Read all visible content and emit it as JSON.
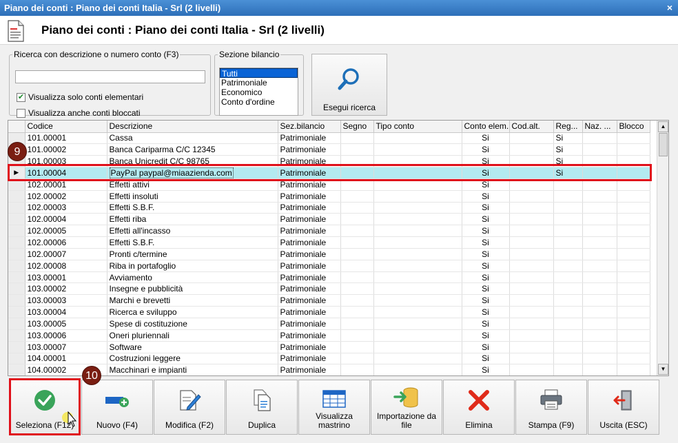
{
  "window": {
    "title": "Piano dei conti : Piano dei conti Italia - Srl (2 livelli)",
    "close_glyph": "×"
  },
  "header": {
    "title": "Piano dei conti : Piano dei conti Italia - Srl (2 livelli)",
    "icon": "document-icon"
  },
  "search": {
    "legend": "Ricerca con descrizione o numero conto (F3)",
    "value": "",
    "placeholder": "",
    "checkbox_elementari": {
      "label": "Visualizza solo conti elementari",
      "checked": true
    },
    "checkbox_bloccati": {
      "label": "Visualizza anche conti bloccati",
      "checked": false
    }
  },
  "sezione": {
    "legend": "Sezione bilancio",
    "options": [
      "Tutti",
      "Patrimoniale",
      "Economico",
      "Conto d'ordine"
    ],
    "selected": "Tutti"
  },
  "search_button": {
    "label": "Esegui ricerca",
    "icon": "magnifier-icon"
  },
  "grid": {
    "columns": [
      "Codice",
      "Descrizione",
      "Sez.bilancio",
      "Segno",
      "Tipo conto",
      "Conto elem.",
      "Cod.alt.",
      "Reg...",
      "Naz. ...",
      "Blocco"
    ],
    "selected_row_index": 3,
    "rows": [
      [
        "101.00001",
        "Cassa",
        "Patrimoniale",
        "",
        "",
        "Si",
        "",
        "Si",
        "",
        ""
      ],
      [
        "101.00002",
        "Banca Cariparma C/C 12345",
        "Patrimoniale",
        "",
        "",
        "Si",
        "",
        "Si",
        "",
        ""
      ],
      [
        "101.00003",
        "Banca Unicredit C/C 98765",
        "Patrimoniale",
        "",
        "",
        "Si",
        "",
        "Si",
        "",
        ""
      ],
      [
        "101.00004",
        "PayPal paypal@miaazienda.com",
        "Patrimoniale",
        "",
        "",
        "Si",
        "",
        "Si",
        "",
        ""
      ],
      [
        "102.00001",
        "Effetti attivi",
        "Patrimoniale",
        "",
        "",
        "Si",
        "",
        "",
        "",
        ""
      ],
      [
        "102.00002",
        "Effetti insoluti",
        "Patrimoniale",
        "",
        "",
        "Si",
        "",
        "",
        "",
        ""
      ],
      [
        "102.00003",
        "Effetti S.B.F.",
        "Patrimoniale",
        "",
        "",
        "Si",
        "",
        "",
        "",
        ""
      ],
      [
        "102.00004",
        "Effetti riba",
        "Patrimoniale",
        "",
        "",
        "Si",
        "",
        "",
        "",
        ""
      ],
      [
        "102.00005",
        "Effetti all'incasso",
        "Patrimoniale",
        "",
        "",
        "Si",
        "",
        "",
        "",
        ""
      ],
      [
        "102.00006",
        "Effetti S.B.F.",
        "Patrimoniale",
        "",
        "",
        "Si",
        "",
        "",
        "",
        ""
      ],
      [
        "102.00007",
        "Pronti c/termine",
        "Patrimoniale",
        "",
        "",
        "Si",
        "",
        "",
        "",
        ""
      ],
      [
        "102.00008",
        "Riba in portafoglio",
        "Patrimoniale",
        "",
        "",
        "Si",
        "",
        "",
        "",
        ""
      ],
      [
        "103.00001",
        "Avviamento",
        "Patrimoniale",
        "",
        "",
        "Si",
        "",
        "",
        "",
        ""
      ],
      [
        "103.00002",
        "Insegne e pubblicità",
        "Patrimoniale",
        "",
        "",
        "Si",
        "",
        "",
        "",
        ""
      ],
      [
        "103.00003",
        "Marchi e brevetti",
        "Patrimoniale",
        "",
        "",
        "Si",
        "",
        "",
        "",
        ""
      ],
      [
        "103.00004",
        "Ricerca e sviluppo",
        "Patrimoniale",
        "",
        "",
        "Si",
        "",
        "",
        "",
        ""
      ],
      [
        "103.00005",
        "Spese di costituzione",
        "Patrimoniale",
        "",
        "",
        "Si",
        "",
        "",
        "",
        ""
      ],
      [
        "103.00006",
        "Oneri pluriennali",
        "Patrimoniale",
        "",
        "",
        "Si",
        "",
        "",
        "",
        ""
      ],
      [
        "103.00007",
        "Software",
        "Patrimoniale",
        "",
        "",
        "Si",
        "",
        "",
        "",
        ""
      ],
      [
        "104.00001",
        "Costruzioni leggere",
        "Patrimoniale",
        "",
        "",
        "Si",
        "",
        "",
        "",
        ""
      ],
      [
        "104.00002",
        "Macchinari e impianti",
        "Patrimoniale",
        "",
        "",
        "Si",
        "",
        "",
        "",
        ""
      ]
    ]
  },
  "annotations": {
    "step_row": "9",
    "step_button": "10",
    "highlight_color": "#e0101a",
    "badge_color": "#7a1e12"
  },
  "toolbar": [
    {
      "id": "seleziona",
      "label": "Seleziona (F12)",
      "icon": "check-circle-icon"
    },
    {
      "id": "nuovo",
      "label": "Nuovo (F4)",
      "icon": "add-item-icon"
    },
    {
      "id": "modifica",
      "label": "Modifica (F2)",
      "icon": "edit-pencil-icon"
    },
    {
      "id": "duplica",
      "label": "Duplica",
      "icon": "duplicate-icon"
    },
    {
      "id": "mastrino",
      "label": "Visualizza mastrino",
      "icon": "table-grid-icon"
    },
    {
      "id": "importazione",
      "label": "Importazione da file",
      "icon": "database-import-icon"
    },
    {
      "id": "elimina",
      "label": "Elimina",
      "icon": "delete-x-icon"
    },
    {
      "id": "stampa",
      "label": "Stampa (F9)",
      "icon": "printer-icon"
    },
    {
      "id": "uscita",
      "label": "Uscita (ESC)",
      "icon": "exit-door-icon"
    }
  ],
  "colors": {
    "titlebar": "#2d6fb8",
    "selected_row": "#b3eaf0",
    "list_selection": "#0a64d6"
  }
}
